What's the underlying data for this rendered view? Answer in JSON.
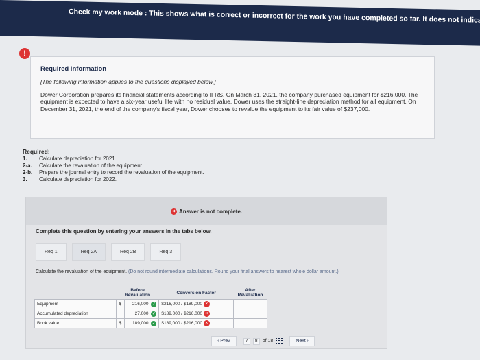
{
  "banner": {
    "text": "Check my work mode : This shows what is correct or incorrect for the work you have completed so far. It does not indicate com"
  },
  "info": {
    "alert_glyph": "!",
    "title": "Required information",
    "note": "[The following information applies to the questions displayed below.]",
    "paragraph": "Dower Corporation prepares its financial statements according to IFRS. On March 31, 2021, the company purchased equipment for $216,000. The equipment is expected to have a six-year useful life with no residual value. Dower uses the straight-line depreciation method for all equipment. On December 31, 2021, the end of the company's fiscal year, Dower chooses to revalue the equipment to its fair value of $237,000."
  },
  "required": {
    "header": "Required:",
    "items": [
      {
        "num": "1.",
        "text": "Calculate depreciation for 2021."
      },
      {
        "num": "2-a.",
        "text": "Calculate the revaluation of the equipment."
      },
      {
        "num": "2-b.",
        "text": "Prepare the journal entry to record the revaluation of the equipment."
      },
      {
        "num": "3.",
        "text": "Calculate depreciation for 2022."
      }
    ]
  },
  "answer": {
    "status_text": "Answer is not complete.",
    "instruction": "Complete this question by entering your answers in the tabs below.",
    "tabs": [
      "Req 1",
      "Req 2A",
      "Req 2B",
      "Req 3"
    ],
    "calc_note_main": "Calculate the revaluation of the equipment.",
    "calc_note_paren": "(Do not round intermediate calculations. Round your final answers to nearest whole dollar amount.)",
    "headers": {
      "before": "Before Revaluation",
      "conversion": "Conversion Factor",
      "after": "After Revaluation"
    },
    "rows": [
      {
        "label": "Equipment",
        "currency": "$",
        "before": "216,000",
        "conversion": "$216,000 / $189,000"
      },
      {
        "label": "Accumulated depreciation",
        "currency": "",
        "before": "27,000",
        "conversion": "$189,000 / $216,000"
      },
      {
        "label": "Book value",
        "currency": "$",
        "before": "189,000",
        "conversion": "$189,000 / $216,000"
      }
    ]
  },
  "nav": {
    "prev": "Prev",
    "pages": [
      "7",
      "8"
    ],
    "of_label": "of 18",
    "next": "Next"
  },
  "colors": {
    "banner_bg": "#1c2a4a",
    "alert_red": "#dd3333",
    "check_green": "#2b9b4b"
  }
}
